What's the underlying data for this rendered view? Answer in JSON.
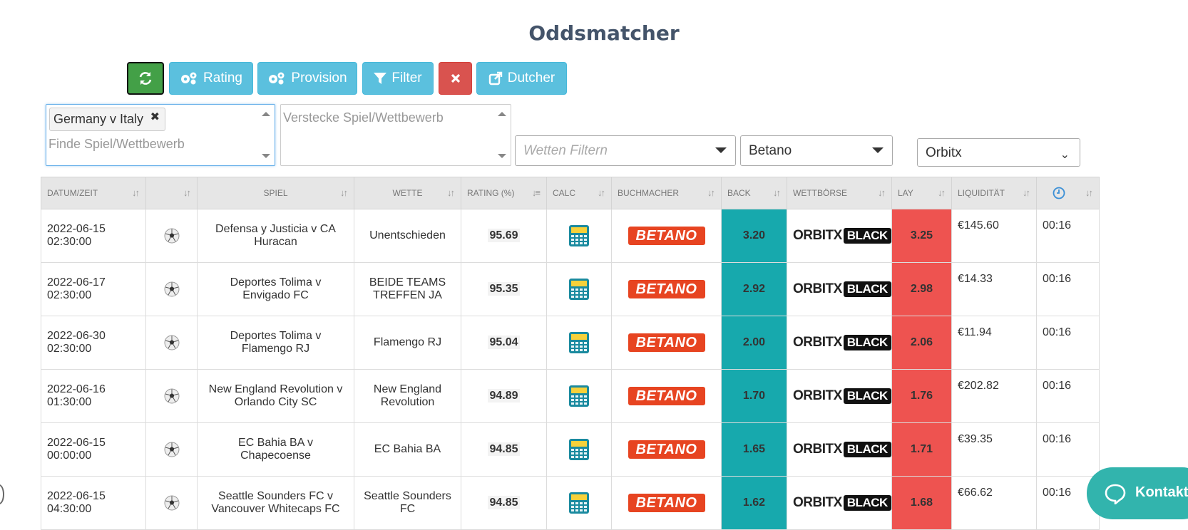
{
  "page": {
    "title": "Oddsmatcher"
  },
  "toolbar": {
    "rating_label": "Rating",
    "provision_label": "Provision",
    "filter_label": "Filter",
    "dutcher_label": "Dutcher"
  },
  "search": {
    "selected_tag": "Germany v Italy",
    "find_placeholder": "Finde Spiel/Wettbewerb",
    "hide_placeholder": "Verstecke Spiel/Wettbewerb"
  },
  "filters": {
    "bets_placeholder": "Wetten Filtern",
    "bookmaker": "Betano",
    "exchange": "Orbitx"
  },
  "table": {
    "headers": [
      "Datum/Zeit",
      "",
      "Spiel",
      "Wette",
      "Rating (%)",
      "Calc",
      "Buchmacher",
      "Back",
      "Wettbörse",
      "Lay",
      "Liquidität",
      ""
    ],
    "rows": [
      {
        "date": "2022-06-15",
        "time": "02:30:00",
        "game_line1": "Defensa y Justicia v CA",
        "game_line2": "Huracan",
        "bet_line1": "Unentschieden",
        "bet_line2": "",
        "rating": "95.69",
        "bookmaker": "BETANO",
        "back": "3.20",
        "exchange": "ORBITX BLACK",
        "lay": "3.25",
        "liquidity": "€145.60",
        "age": "00:16"
      },
      {
        "date": "2022-06-17",
        "time": "02:30:00",
        "game_line1": "Deportes Tolima v",
        "game_line2": "Envigado FC",
        "bet_line1": "BEIDE TEAMS",
        "bet_line2": "TREFFEN JA",
        "rating": "95.35",
        "bookmaker": "BETANO",
        "back": "2.92",
        "exchange": "ORBITX BLACK",
        "lay": "2.98",
        "liquidity": "€14.33",
        "age": "00:16"
      },
      {
        "date": "2022-06-30",
        "time": "02:30:00",
        "game_line1": "Deportes Tolima v",
        "game_line2": "Flamengo RJ",
        "bet_line1": "Flamengo RJ",
        "bet_line2": "",
        "rating": "95.04",
        "bookmaker": "BETANO",
        "back": "2.00",
        "exchange": "ORBITX BLACK",
        "lay": "2.06",
        "liquidity": "€11.94",
        "age": "00:16"
      },
      {
        "date": "2022-06-16",
        "time": "01:30:00",
        "game_line1": "New England Revolution v",
        "game_line2": "Orlando City SC",
        "bet_line1": "New England",
        "bet_line2": "Revolution",
        "rating": "94.89",
        "bookmaker": "BETANO",
        "back": "1.70",
        "exchange": "ORBITX BLACK",
        "lay": "1.76",
        "liquidity": "€202.82",
        "age": "00:16"
      },
      {
        "date": "2022-06-15",
        "time": "00:00:00",
        "game_line1": "EC Bahia BA v",
        "game_line2": "Chapecoense",
        "bet_line1": "EC Bahia BA",
        "bet_line2": "",
        "rating": "94.85",
        "bookmaker": "BETANO",
        "back": "1.65",
        "exchange": "ORBITX BLACK",
        "lay": "1.71",
        "liquidity": "€39.35",
        "age": "00:16"
      },
      {
        "date": "2022-06-15",
        "time": "04:30:00",
        "game_line1": "Seattle Sounders FC v",
        "game_line2": "Vancouver Whitecaps FC",
        "bet_line1": "Seattle Sounders",
        "bet_line2": "FC",
        "rating": "94.85",
        "bookmaker": "BETANO",
        "back": "1.62",
        "exchange": "ORBITX BLACK",
        "lay": "1.68",
        "liquidity": "€66.62",
        "age": "00:16"
      }
    ]
  },
  "kontakt": {
    "label": "Kontakt"
  },
  "colors": {
    "back": "#17a9ad",
    "lay": "#ee5350",
    "info": "#5bc0de",
    "refresh": "#43a047",
    "danger": "#d9534f",
    "bookmaker": "#e74421"
  }
}
